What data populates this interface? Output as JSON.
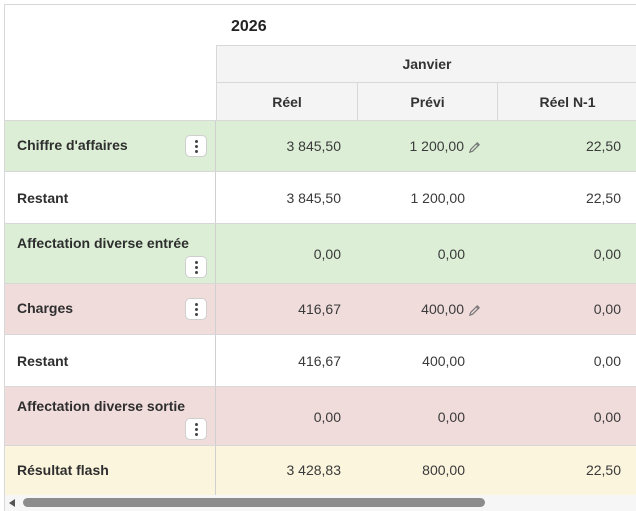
{
  "header": {
    "year": "2026",
    "month": "Janvier",
    "columns": [
      "Réel",
      "Prévi",
      "Réel N-1"
    ]
  },
  "rows": [
    {
      "label": "Chiffre d'affaires",
      "values": [
        "3 845,50",
        "1 200,00",
        "22,50"
      ],
      "editable_previ": true,
      "has_menu": true,
      "color": "#dcefd6"
    },
    {
      "label": "Restant",
      "values": [
        "3 845,50",
        "1 200,00",
        "22,50"
      ],
      "editable_previ": false,
      "has_menu": false,
      "color": "#ffffff"
    },
    {
      "label": "Affectation diverse entrée",
      "values": [
        "0,00",
        "0,00",
        "0,00"
      ],
      "editable_previ": false,
      "has_menu": true,
      "color": "#dcefd6"
    },
    {
      "label": "Charges",
      "values": [
        "416,67",
        "400,00",
        "0,00"
      ],
      "editable_previ": true,
      "has_menu": true,
      "color": "#f1dcdc"
    },
    {
      "label": "Restant",
      "values": [
        "416,67",
        "400,00",
        "0,00"
      ],
      "editable_previ": false,
      "has_menu": false,
      "color": "#ffffff"
    },
    {
      "label": "Affectation diverse sortie",
      "values": [
        "0,00",
        "0,00",
        "0,00"
      ],
      "editable_previ": false,
      "has_menu": true,
      "color": "#f1dcdc"
    },
    {
      "label": "Résultat flash",
      "values": [
        "3 428,83",
        "800,00",
        "22,50"
      ],
      "editable_previ": false,
      "has_menu": false,
      "color": "#fbf5dd"
    }
  ],
  "icons": {
    "menu": "more-vertical-icon",
    "edit": "pencil-icon",
    "scroll": "scroll-left-arrow-icon"
  }
}
